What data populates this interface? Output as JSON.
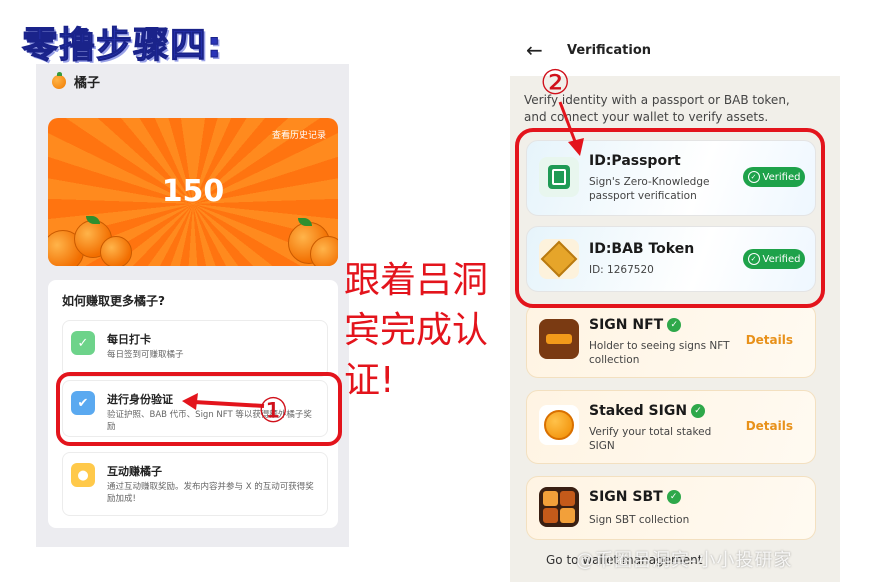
{
  "heading": "零撸步骤四:",
  "left_app": {
    "app_name": "橘子",
    "history_link": "查看历史记录",
    "points": "150",
    "earn_title": "如何赚取更多橘子?",
    "tasks": [
      {
        "title": "每日打卡",
        "desc": "每日签到可赚取橘子",
        "icon": "check-icon",
        "color": "#6dd38a"
      },
      {
        "title": "进行身份验证",
        "desc": "验证护照、BAB 代币、Sign NFT 等以获得额外橘子奖励",
        "icon": "shield-icon",
        "color": "#5aa9f0"
      },
      {
        "title": "互动赚橘子",
        "desc": "通过互动赚取奖励。发布内容并参与 X 的互动可获得奖励加成!",
        "icon": "orange-icon",
        "color": "#ffc94a"
      }
    ]
  },
  "annotation": {
    "marker_1": "①",
    "marker_2": "②",
    "caption_lines": [
      "跟着吕洞",
      "宾完成认",
      "证!"
    ]
  },
  "right_app": {
    "title": "Verification",
    "intro": "Verify identity with a passport or BAB token, and connect your wallet to verify assets.",
    "cards": [
      {
        "title": "ID:Passport",
        "desc": "Sign's Zero-Knowledge passport verification",
        "status": "Verified",
        "icon": "passport-icon"
      },
      {
        "title": "ID:BAB Token",
        "desc": "ID: 1267520",
        "status": "Verified",
        "icon": "bab-token-icon"
      },
      {
        "title": "SIGN NFT",
        "desc": "Holder to seeing signs NFT collection",
        "action": "Details",
        "icon": "sign-nft-icon"
      },
      {
        "title": "Staked SIGN",
        "desc": "Verify your total staked SIGN",
        "action": "Details",
        "icon": "staked-sign-icon"
      },
      {
        "title": "SIGN SBT",
        "desc": "Sign SBT collection",
        "icon": "sign-sbt-icon"
      }
    ],
    "footer": "Go to wallet management"
  },
  "watermark": "@币圈吕洞宾-小小投研家",
  "colors": {
    "accent_red": "#e3141c",
    "verified_green": "#1ea24a",
    "details_orange": "#e8911a",
    "heading_blue": "#2a35b8"
  }
}
